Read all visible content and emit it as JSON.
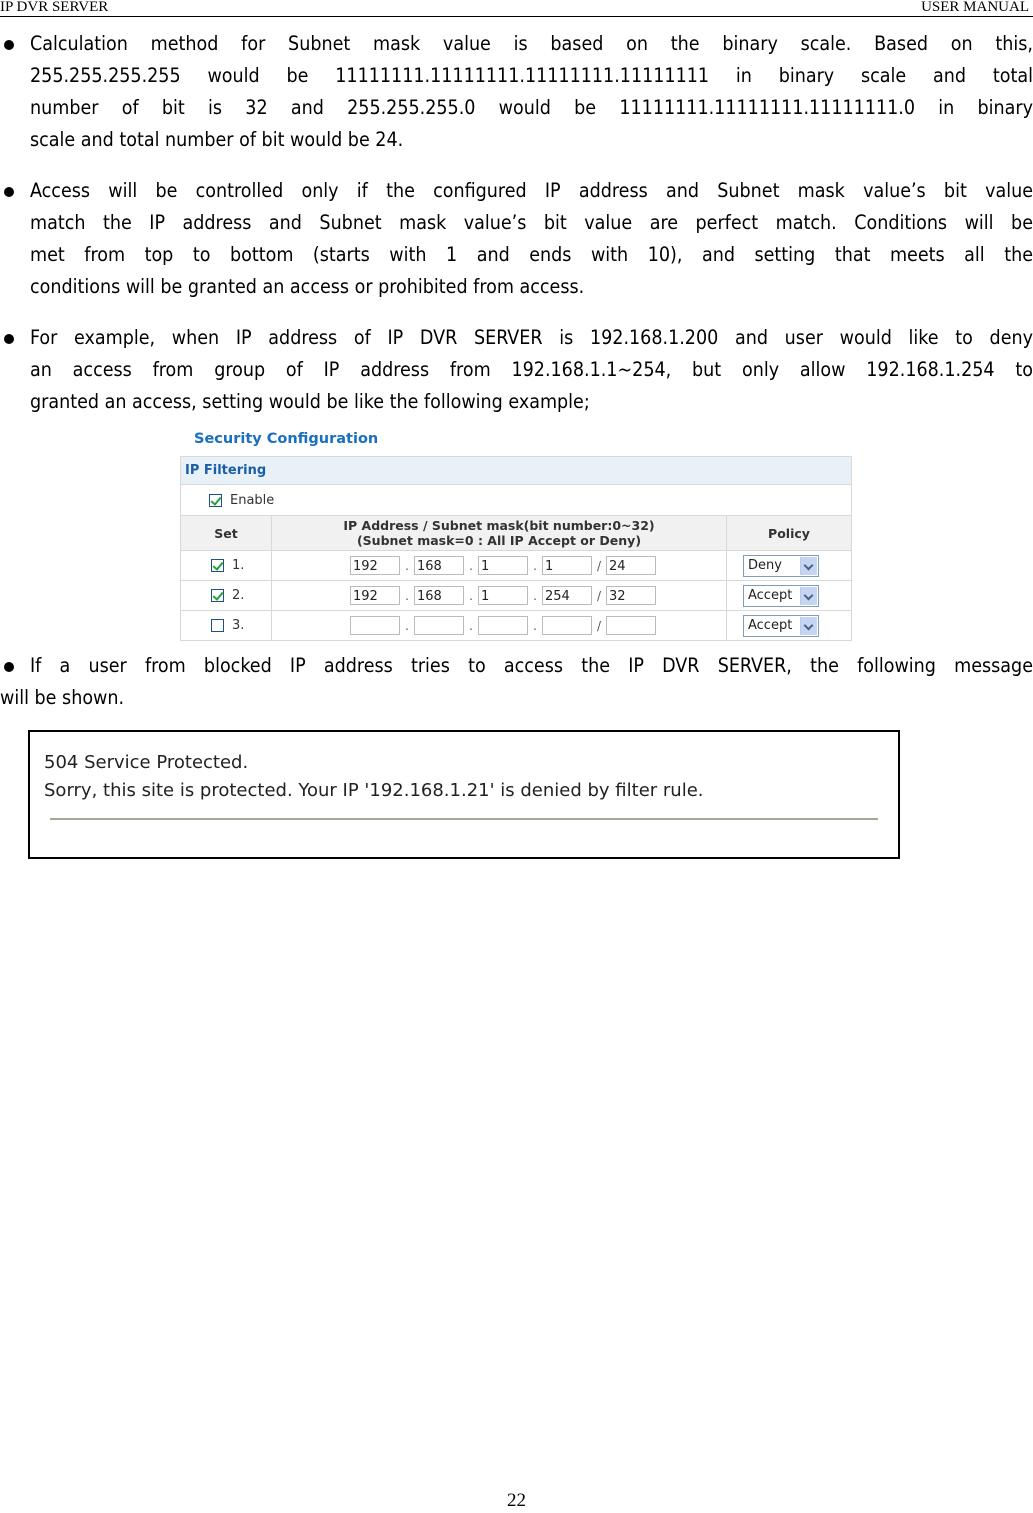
{
  "header": {
    "left": "IP DVR SERVER",
    "right": "USER MANUAL"
  },
  "paragraphs": {
    "p1": [
      "Calculation  method  for  Subnet  mask  value  is  based  on  the  binary  scale.  Based  on  this,",
      "255.255.255.255 would be 11111111.11111111.11111111.11111111 in binary scale and total",
      "number  of  bit  is  32  and  255.255.255.0  would  be  11111111.11111111.11111111.0  in  binary",
      "scale and total number of bit would be 24."
    ],
    "p2": [
      "Access will be controlled only if the configured IP address and Subnet mask value’s bit value",
      "match the IP address and Subnet mask value’s bit value are perfect match. Conditions will be",
      "met  from  top  to  bottom  (starts  with  1  and  ends  with  10),  and  setting  that  meets  all  the",
      "conditions will be granted an access or prohibited from access."
    ],
    "p3": [
      "For example, when IP address of IP DVR SERVER is 192.168.1.200 and user would like to deny",
      "an access from group of IP address from 192.168.1.1~254, but only allow 192.168.1.254 to",
      "granted an access, setting would be like the following example;"
    ],
    "p4": [
      "If a user from blocked IP address tries to access the IP DVR SERVER, the following message",
      "will be shown."
    ]
  },
  "security_config": {
    "title": "Security Configuration",
    "section": "IP Filtering",
    "enable": {
      "label": "Enable",
      "checked": true
    },
    "columns": {
      "set": "Set",
      "ip_line1": "IP Address / Subnet mask(bit number:0~32)",
      "ip_line2": "(Subnet mask=0  : All IP Accept or Deny)",
      "policy": "Policy"
    },
    "rules": [
      {
        "index": "1.",
        "checked": true,
        "octets": [
          "192",
          "168",
          "1",
          "1"
        ],
        "mask": "24",
        "policy": "Deny"
      },
      {
        "index": "2.",
        "checked": true,
        "octets": [
          "192",
          "168",
          "1",
          "254"
        ],
        "mask": "32",
        "policy": "Accept"
      },
      {
        "index": "3.",
        "checked": false,
        "octets": [
          "",
          "",
          "",
          ""
        ],
        "mask": "",
        "policy": "Accept"
      }
    ]
  },
  "error_message": {
    "line1": "504 Service Protected.",
    "line2": "Sorry, this site is protected. Your IP '192.168.1.21' is denied by filter rule."
  },
  "footer": {
    "page_number": "22"
  }
}
